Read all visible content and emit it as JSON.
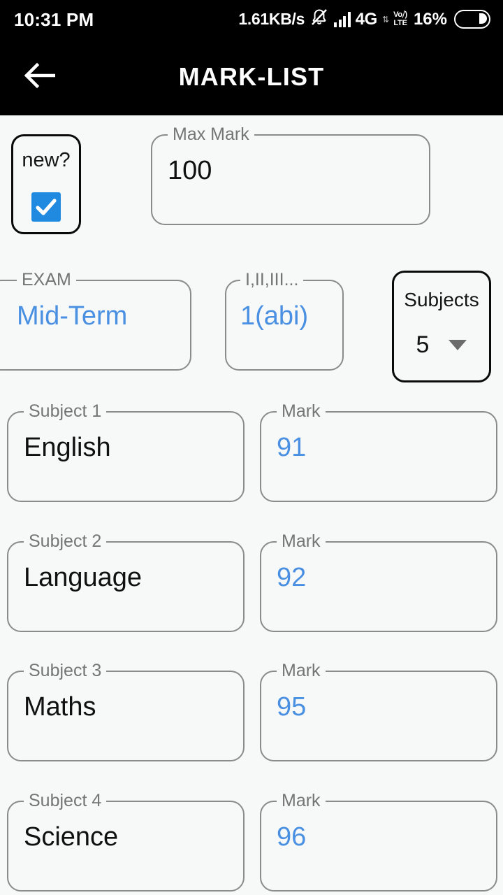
{
  "status_bar": {
    "clock": "10:31 PM",
    "net_speed": "1.61KB/s",
    "mute_icon": "bell-muted-icon",
    "signal_icon": "signal-bars-icon",
    "network_type": "4G",
    "data_arrows": "⇅",
    "volte_top": "Vo⧸)",
    "volte_bottom": "LTE",
    "battery_percent": "16%",
    "battery_icon": "battery-icon"
  },
  "app_bar": {
    "back_icon": "back-arrow-icon",
    "title": "MARK-LIST"
  },
  "form": {
    "new_card": {
      "label": "new?",
      "checked": true,
      "check_icon": "check-icon"
    },
    "max_mark": {
      "label": "Max Mark",
      "value": "100"
    },
    "exam": {
      "label": "EXAM",
      "value": "Mid-Term"
    },
    "roman": {
      "label": "I,II,III...",
      "value": "1(abi)"
    },
    "subjects": {
      "label": "Subjects",
      "value": "5",
      "caret_icon": "chevron-down-icon"
    },
    "mark_label": "Mark",
    "rows": [
      {
        "subject_label": "Subject 1",
        "subject_value": "English",
        "mark_label": "Mark",
        "mark_value": "91"
      },
      {
        "subject_label": "Subject 2",
        "subject_value": "Language",
        "mark_label": "Mark",
        "mark_value": "92"
      },
      {
        "subject_label": "Subject 3",
        "subject_value": "Maths",
        "mark_label": "Mark",
        "mark_value": "95"
      },
      {
        "subject_label": "Subject 4",
        "subject_value": "Science",
        "mark_label": "Mark",
        "mark_value": "96"
      }
    ]
  },
  "colors": {
    "accent_blue": "#4a90e2",
    "checkbox_blue": "#2089e0",
    "bar_black": "#000000",
    "background": "#f7f8f8",
    "outline_grey": "#8b8b8b",
    "label_grey": "#757575"
  }
}
